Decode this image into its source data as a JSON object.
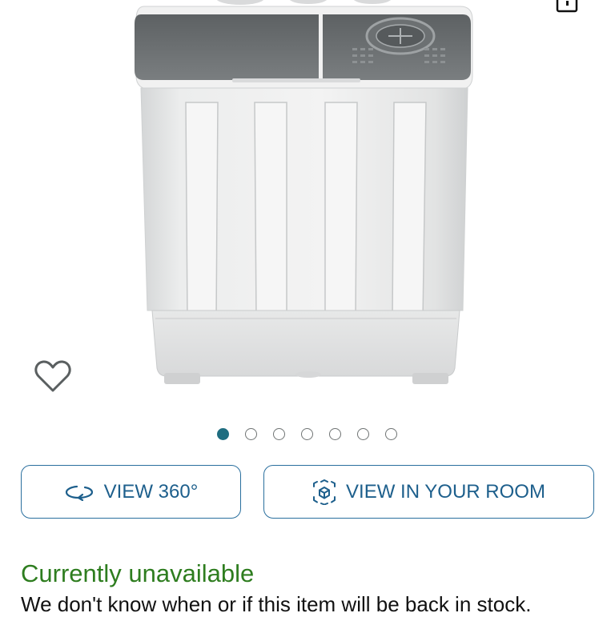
{
  "product": {
    "image_alt": "Twin tub portable washing machine",
    "image_count": 7,
    "active_image_index": 0
  },
  "icons": {
    "wishlist": "heart-outline-icon",
    "share": "share-icon",
    "view_360": "rotate-360-icon",
    "view_in_room": "ar-cube-icon"
  },
  "actions": {
    "view_360_label": "VIEW 360°",
    "view_in_room_label": "VIEW IN YOUR ROOM"
  },
  "availability": {
    "status": "Currently unavailable",
    "message": "We don't know when or if this item will be back in stock."
  },
  "colors": {
    "accent": "#1d5f8c",
    "status_green": "#2e7d1f",
    "active_dot": "#1f6d80"
  }
}
